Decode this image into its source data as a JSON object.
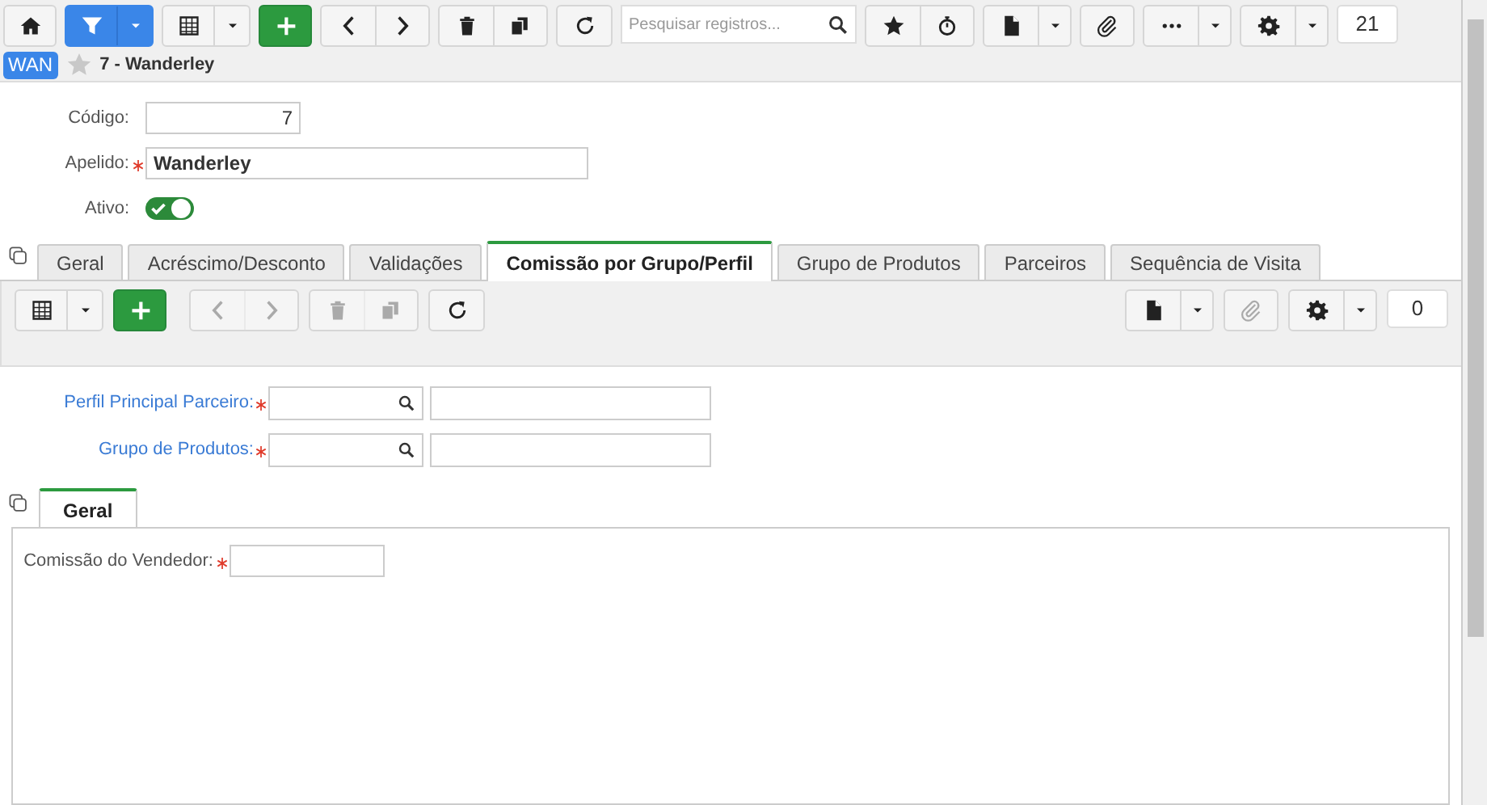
{
  "toolbar": {
    "search": {
      "placeholder": "Pesquisar registros..."
    },
    "counter": "21"
  },
  "header": {
    "badge": "WAN",
    "favorite": false,
    "title": "7 - Wanderley"
  },
  "form": {
    "fields": [
      {
        "label": "Código:",
        "required": false,
        "value": "7",
        "kind": "number"
      },
      {
        "label": "Apelido:",
        "required": true,
        "value": "Wanderley",
        "kind": "text"
      },
      {
        "label": "Ativo:",
        "required": false,
        "on": true,
        "kind": "toggle"
      }
    ]
  },
  "tabs": [
    {
      "label": "Geral",
      "selected": false
    },
    {
      "label": "Acréscimo/Desconto",
      "selected": false
    },
    {
      "label": "Validações",
      "selected": false
    },
    {
      "label": "Comissão por Grupo/Perfil",
      "selected": true
    },
    {
      "label": "Grupo de Produtos",
      "selected": false
    },
    {
      "label": "Parceiros",
      "selected": false
    },
    {
      "label": "Sequência de Visita",
      "selected": false
    }
  ],
  "subtoolbar": {
    "buttons": [
      {
        "disabled": false
      },
      {
        "disabled": false
      },
      {
        "disabled": true
      },
      {
        "disabled": true
      },
      {
        "disabled": true
      },
      {
        "disabled": true
      },
      {
        "disabled": false
      },
      {
        "disabled": false
      },
      {
        "disabled": true
      },
      {
        "disabled": false
      }
    ],
    "counter": "0"
  },
  "lookups": [
    {
      "label": "Perfil Principal Parceiro:",
      "required": true
    },
    {
      "label": "Grupo de Produtos:",
      "required": true
    }
  ],
  "inner_tabs": [
    {
      "label": "Geral",
      "selected": true
    }
  ],
  "inner_fields": [
    {
      "label": "Comissão do Vendedor:",
      "required": true
    }
  ]
}
